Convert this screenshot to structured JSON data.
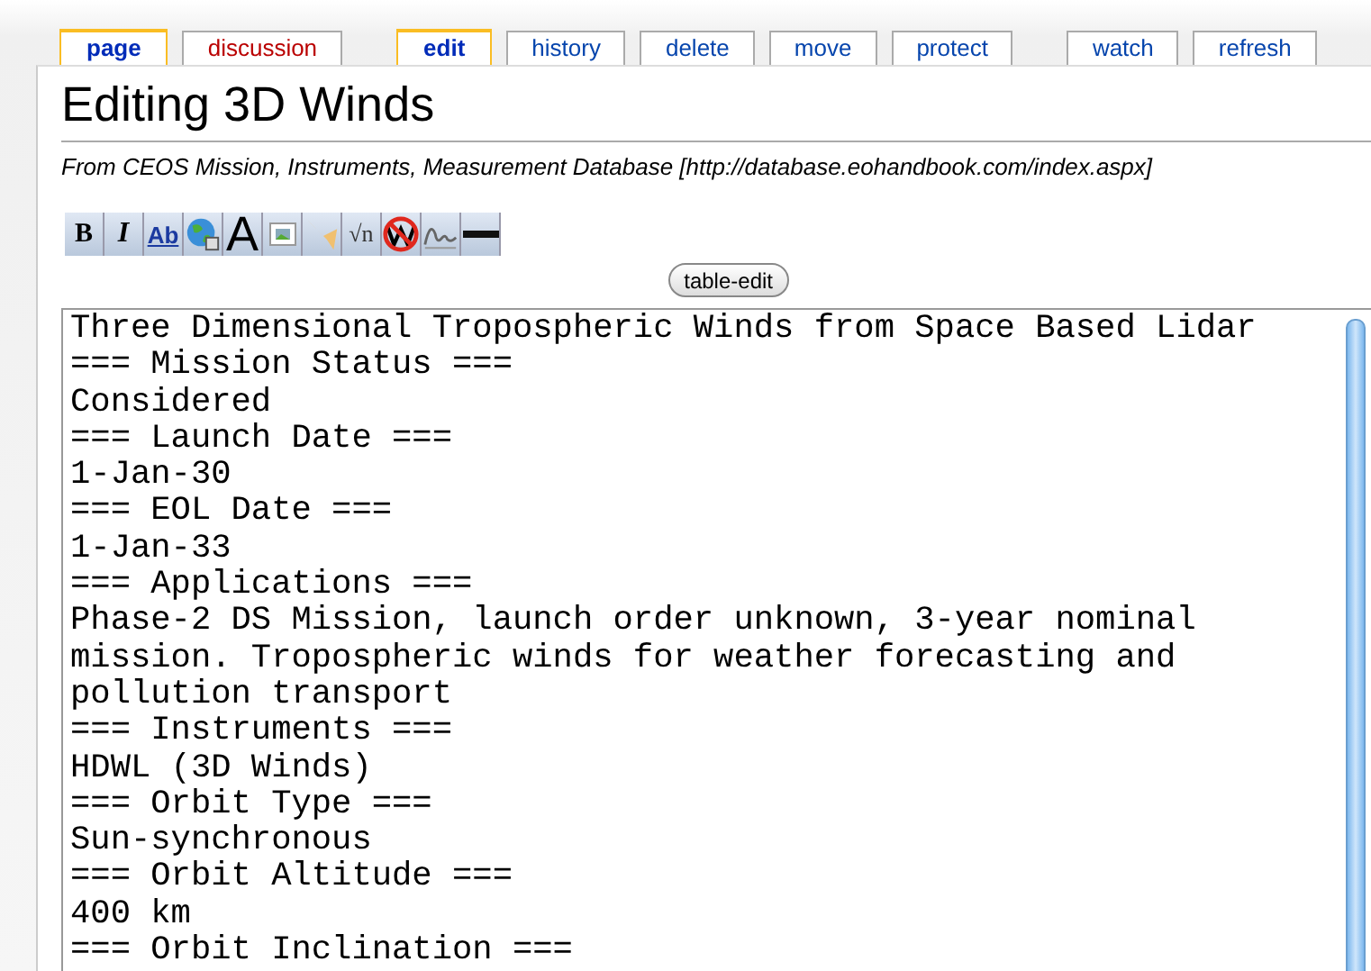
{
  "tabs": [
    {
      "label": "page",
      "selected": true,
      "kind": "page"
    },
    {
      "label": "discussion",
      "selected": false,
      "kind": "redlink"
    },
    {
      "label": "edit",
      "selected": true,
      "kind": "gap"
    },
    {
      "label": "history",
      "selected": false,
      "kind": "page"
    },
    {
      "label": "delete",
      "selected": false,
      "kind": "page"
    },
    {
      "label": "move",
      "selected": false,
      "kind": "page"
    },
    {
      "label": "protect",
      "selected": false,
      "kind": "page"
    },
    {
      "label": "watch",
      "selected": false,
      "kind": "gap"
    },
    {
      "label": "refresh",
      "selected": false,
      "kind": "page"
    }
  ],
  "title": "Editing 3D Winds",
  "subtitle": "From CEOS Mission, Instruments, Measurement Database [http://database.eohandbook.com/index.aspx]",
  "toolbar": [
    {
      "kind": "bold",
      "label": "B"
    },
    {
      "kind": "italic",
      "label": "I"
    },
    {
      "kind": "link",
      "label": "Ab"
    },
    {
      "kind": "globe"
    },
    {
      "kind": "headline",
      "label": "A"
    },
    {
      "kind": "image"
    },
    {
      "kind": "media"
    },
    {
      "kind": "math",
      "label": "√n"
    },
    {
      "kind": "nowiki"
    },
    {
      "kind": "signature"
    },
    {
      "kind": "rule"
    }
  ],
  "table_edit_button": "table-edit",
  "editor_lines": [
    "Three Dimensional Tropospheric Winds from Space Based Lidar",
    "=== Mission Status ===",
    "Considered",
    "=== Launch Date ===",
    "1-Jan-30",
    "=== EOL Date ===",
    "1-Jan-33",
    "=== Applications ===",
    "Phase-2 DS Mission, launch order unknown, 3-year nominal",
    "mission. Tropospheric winds for weather forecasting and",
    "pollution transport",
    "=== Instruments ===",
    "HDWL (3D Winds)",
    "=== Orbit Type ===",
    "Sun-synchronous",
    "=== Orbit Altitude ===",
    "400 km",
    "=== Orbit Inclination ==="
  ]
}
